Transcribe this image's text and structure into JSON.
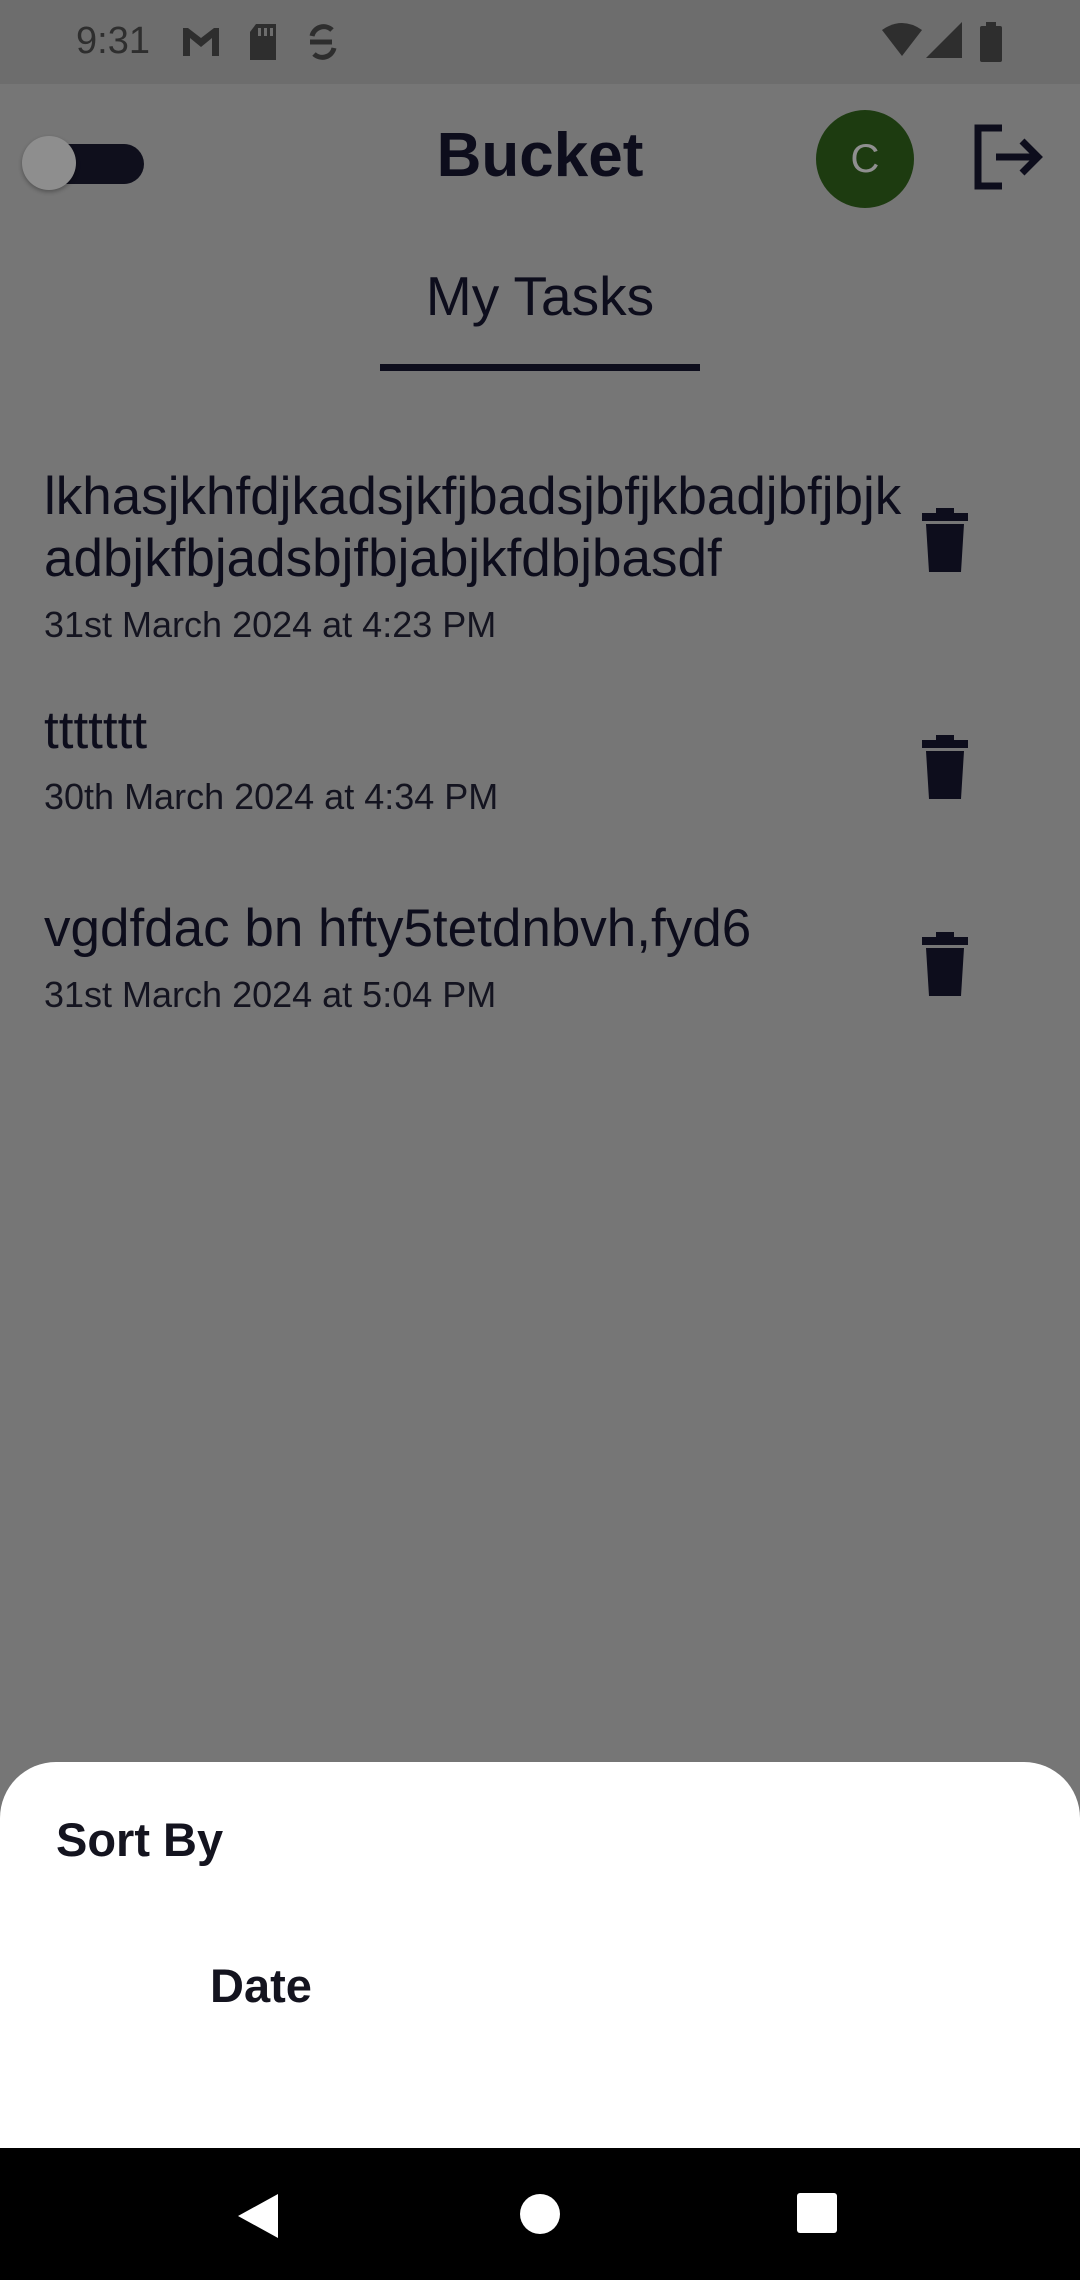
{
  "status_bar": {
    "time": "9:31",
    "icons": [
      "gmail-icon",
      "sd-card-icon",
      "sync-icon",
      "wifi-icon",
      "signal-icon",
      "battery-icon"
    ]
  },
  "app_bar": {
    "title": "Bucket",
    "avatar_letter": "C",
    "theme_toggle": "dark-mode-toggle",
    "logout_icon": "logout-icon"
  },
  "tabs": {
    "active": "My Tasks"
  },
  "tasks": [
    {
      "title": "lkhasjkhfdjkadsjkfjbadsjbfjkbadjbfjbjkadbjkfbjadsbjfbjabjkfdbjbasdf",
      "date": "31st March 2024 at 4:23 PM"
    },
    {
      "title": "ttttttt",
      "date": "30th March 2024 at 4:34 PM"
    },
    {
      "title": "vgdfdac bn hfty5tetdnbvh,fyd6",
      "date": "31st March 2024 at 5:04 PM"
    }
  ],
  "sort_sheet": {
    "title": "Sort By",
    "options": [
      "Date"
    ]
  },
  "colors": {
    "scrim": "#767676",
    "text_dark": "#0d0d1c",
    "avatar_bg": "#1d3b10",
    "sheet_bg": "#ffffff",
    "nav_bar": "#000000"
  }
}
